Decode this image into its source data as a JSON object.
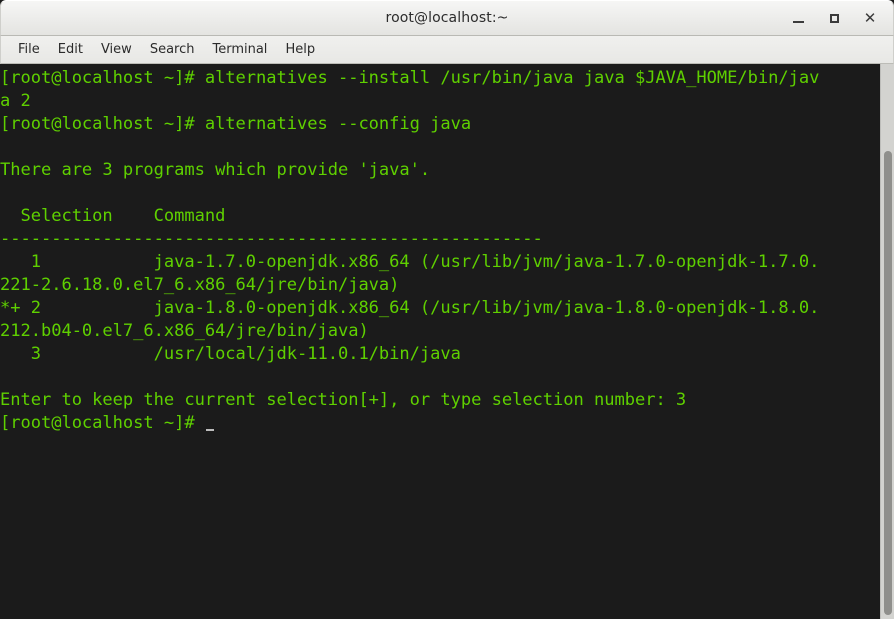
{
  "window": {
    "title": "root@localhost:~",
    "controls": {
      "minimize": "minimize",
      "maximize": "maximize",
      "close": "✕"
    }
  },
  "menubar": {
    "items": [
      {
        "label": "File"
      },
      {
        "label": "Edit"
      },
      {
        "label": "View"
      },
      {
        "label": "Search"
      },
      {
        "label": "Terminal"
      },
      {
        "label": "Help"
      }
    ]
  },
  "terminal": {
    "colors": {
      "background": "#1b1b1b",
      "foreground": "#5fd000",
      "cursor": "#bdbdbd"
    },
    "prompt": "[root@localhost ~]#",
    "cursor_glyph": "_",
    "lines": [
      "[root@localhost ~]# alternatives --install /usr/bin/java java $JAVA_HOME/bin/jav",
      "a 2",
      "[root@localhost ~]# alternatives --config java",
      "",
      "There are 3 programs which provide 'java'.",
      "",
      "  Selection    Command",
      "-----------------------------------------------------",
      "   1           java-1.7.0-openjdk.x86_64 (/usr/lib/jvm/java-1.7.0-openjdk-1.7.0.",
      "221-2.6.18.0.el7_6.x86_64/jre/bin/java)",
      "*+ 2           java-1.8.0-openjdk.x86_64 (/usr/lib/jvm/java-1.8.0-openjdk-1.8.0.",
      "212.b04-0.el7_6.x86_64/jre/bin/java)",
      "   3           /usr/local/jdk-11.0.1/bin/java",
      "",
      "Enter to keep the current selection[+], or type selection number: 3"
    ],
    "last_prompt": "[root@localhost ~]# "
  },
  "scrollbar": {
    "orientation": "vertical",
    "thumb_label": "scroll-thumb"
  }
}
